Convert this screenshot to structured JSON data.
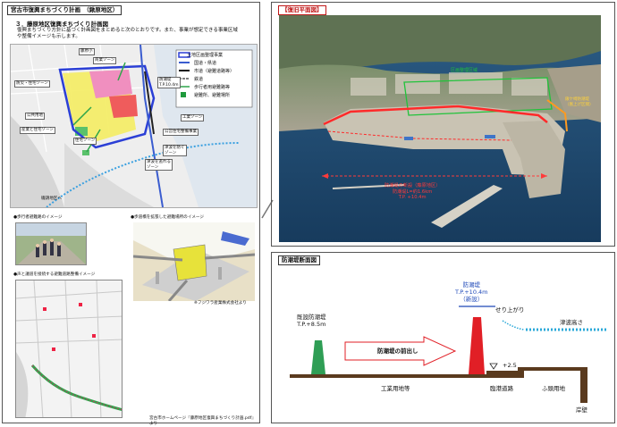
{
  "left_panel": {
    "title": "宮古市復興まちづくり計画　（鍬原地区）",
    "section_heading": "３．藤原地区復興まちづくり計画図",
    "description": "復興まちづくり方針に基づく計画図をまとめると次のとおりです。また、事業が想定できる事業区域や整備イメージも示します。",
    "legend": [
      {
        "label": "土地区画整理事業",
        "color": "#2b3fd6"
      },
      {
        "label": "国道・県道",
        "color": "#3a5ccf"
      },
      {
        "label": "市道（避難道路等）",
        "color": "#111111"
      },
      {
        "label": "鉄道",
        "color": "#555555"
      },
      {
        "label": "歩行者用避難路等",
        "color": "#2ea64a"
      },
      {
        "label": "避難所、避難場所",
        "color": "#1f9a3c"
      }
    ],
    "map_labels": {
      "top_left": "藤原小",
      "zone_commerce": "商業ゾーン",
      "zone_residential_1": "防災・住宅ゾーン",
      "zone_residential_2": "住宅ゾーン",
      "zone_park": "公共用地",
      "zone_industry": "工業ゾーン",
      "zone_public": "公営住宅整備事業",
      "zone_life": "産業と住宅ゾーン",
      "callout_1": "防潮堤\nT.P.10.4m",
      "callout_2": "津波を防ぐ\nゾーン",
      "callout_3": "津波を逃れる\nゾーン",
      "bottom_label": "磯鶏地区へ"
    },
    "sub_images": {
      "evac_road": "●歩行者避難路のイメージ",
      "bridge_evac": "●歩道橋を拡張した避難場所のイメージ",
      "road_map": "●声と議道を接続する避難道路整備イメージ",
      "credit": "※フジワラ産業株式会社より"
    },
    "footer": "宮古市ホームページ『藤原地区復興まちづくり計画.pdf』より"
  },
  "right_top": {
    "title": "【復旧平面図】",
    "label_green": "区画整理区域",
    "label_right": "鍬ケ崎防潮堤\n（嵩上げ区間）",
    "label_red": "防潮堤の新設（藤原地区）\n防潮堤L=約1.6km\nT.P. +10.4m"
  },
  "right_bottom": {
    "title": "防潮堤断面図",
    "existing_wall": "既設防潮堤\nT.P.+8.5m",
    "new_wall": "防潮堤\nT.P.+10.4m\n（新設）",
    "move_forward": "防潮堤の前出し",
    "rise": "せり上がり",
    "tsunami_height": "津波高さ",
    "ground_level": "+2.5",
    "industrial": "工業用地等",
    "coastal_road": "臨港道路",
    "wharf": "ふ頭用地",
    "quay": "岸壁"
  },
  "colors": {
    "new_wall": "#e11f26",
    "old_wall": "#2f9e55",
    "ground": "#5a3a1e",
    "tsunami": "#2aa8d8",
    "arrow": "#e11f26"
  }
}
